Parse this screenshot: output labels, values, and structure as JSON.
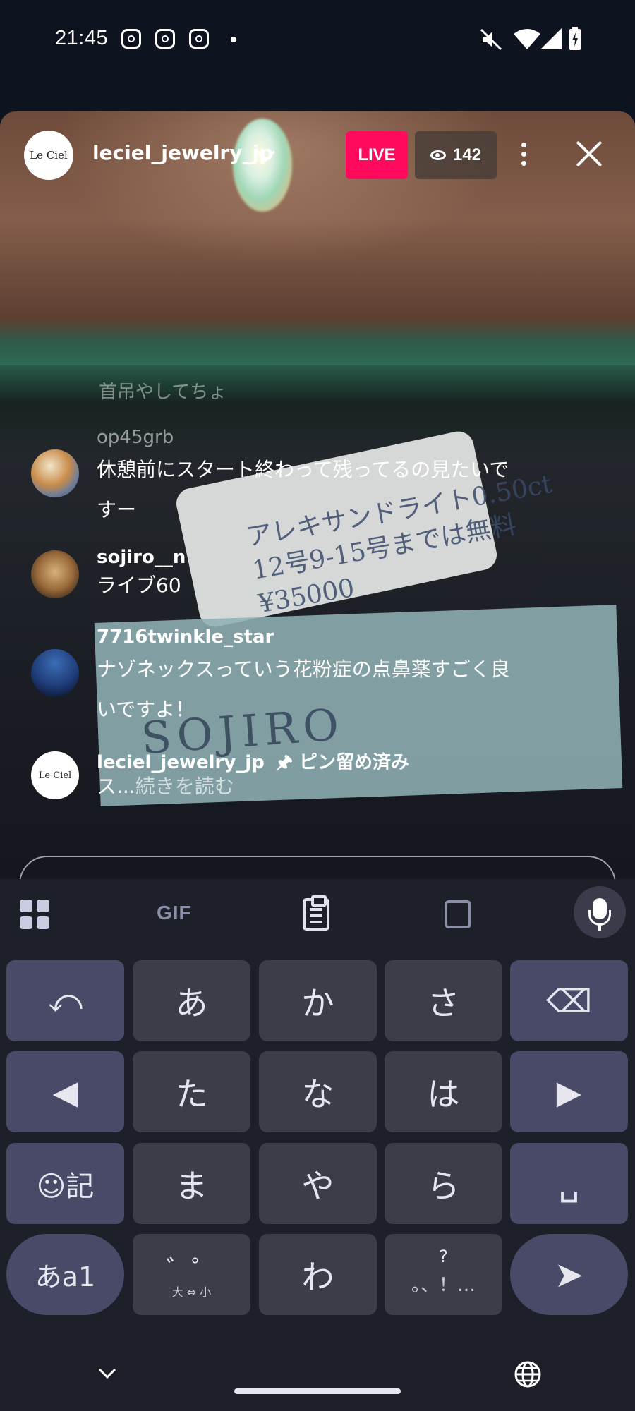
{
  "status_bar": {
    "time": "21:45",
    "notification_icons": [
      "instagram-icon",
      "instagram-icon",
      "instagram-icon"
    ],
    "system_icons": [
      "mute-icon",
      "wifi-icon",
      "signal-icon",
      "battery-charging-icon"
    ]
  },
  "live": {
    "account": "leciel_jewelry_jp",
    "avatar_logo": "Le Ciel",
    "live_badge": "LIVE",
    "viewer_count": "142",
    "accent_color": "#ff0a5d"
  },
  "video_overlay_text": {
    "tag_line1": "アレキサンドライト0.50ct",
    "tag_line2": "12号9-15号までは無料",
    "tag_line3": "¥35000",
    "card_text": "SOJIRO"
  },
  "comments": {
    "faded_partial": "首吊やしてちょ",
    "items": [
      {
        "user": "op45grb",
        "text": "休憩前にスタート終わって残ってるの見たいですー"
      },
      {
        "user": "sojiro__n",
        "text": "ライブ60"
      },
      {
        "user": "7716twinkle_star",
        "text": "ナゾネックスっていう花粉症の点鼻薬すごく良いですよ！"
      },
      {
        "user": "leciel_jewelry_jp",
        "pinned_label": "ピン留め済み",
        "text": "ス...",
        "more": "続きを読む"
      }
    ]
  },
  "keyboard": {
    "toolbar": {
      "gif": "GIF"
    },
    "rows": [
      [
        "⤺",
        "あ",
        "か",
        "さ",
        "⌫"
      ],
      [
        "◀",
        "た",
        "な",
        "は",
        "▶"
      ],
      [
        "☺記",
        "ま",
        "や",
        "ら",
        "␣"
      ],
      [
        "あa1",
        "゛゜",
        "わ",
        "、。?!",
        "➤"
      ]
    ],
    "dakuten_sub": "大 ⇔ 小",
    "punct_main": "?",
    "punct_sub": "。、！…"
  }
}
